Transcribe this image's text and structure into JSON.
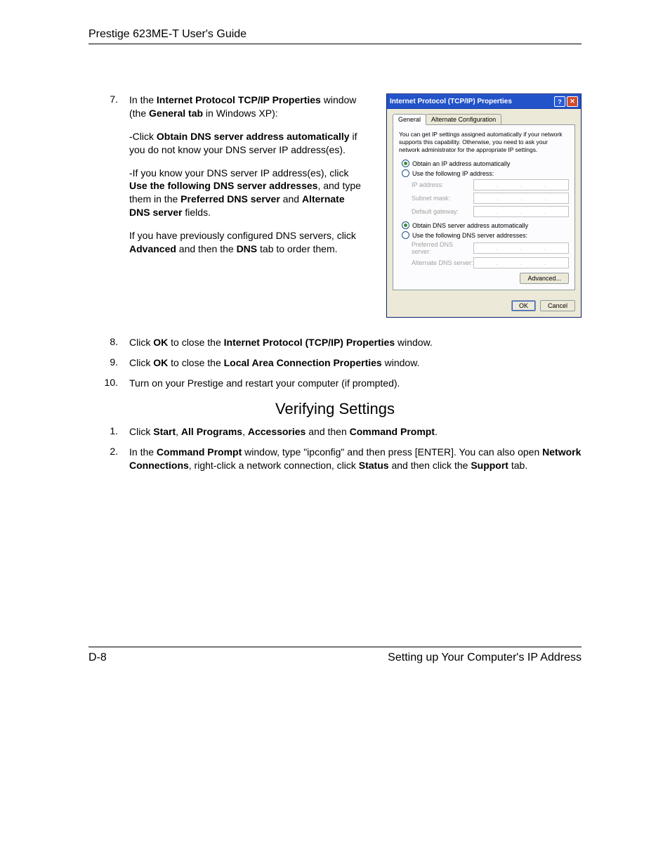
{
  "header": {
    "title": "Prestige 623ME-T User's Guide"
  },
  "footer": {
    "page": "D-8",
    "section": "Setting up Your Computer's IP Address"
  },
  "doc": {
    "step7": {
      "num": "7.",
      "p1a": "In the ",
      "p1b": "Internet Protocol TCP/IP Properties",
      "p1c": " window (the ",
      "p1d": "General tab",
      "p1e": " in Windows XP):",
      "p2a": "-Click ",
      "p2b": "Obtain DNS server address automatically",
      "p2c": " if you do not know your DNS server IP address(es).",
      "p3a": "-If you know your DNS server IP address(es), click ",
      "p3b": "Use the following DNS server addresses",
      "p3c": ", and type them in the ",
      "p3d": "Preferred DNS server",
      "p3e": " and ",
      "p3f": "Alternate DNS server",
      "p3g": " fields.",
      "p4a": "If you have previously configured DNS servers, click ",
      "p4b": "Advanced",
      "p4c": " and then the ",
      "p4d": "DNS",
      "p4e": " tab to order them."
    },
    "step8": {
      "num": "8.",
      "a": "Click ",
      "b": "OK",
      "c": " to close the ",
      "d": "Internet Protocol (TCP/IP) Properties",
      "e": " window."
    },
    "step9": {
      "num": "9.",
      "a": "Click ",
      "b": "OK",
      "c": " to close the ",
      "d": "Local Area Connection Properties",
      "e": " window."
    },
    "step10": {
      "num": "10.",
      "a": "Turn on your Prestige and restart your computer (if prompted)."
    },
    "section_title": "Verifying Settings",
    "v1": {
      "num": "1.",
      "a": "Click ",
      "b": "Start",
      "c": ", ",
      "d": "All Programs",
      "e": ", ",
      "f": "Accessories",
      "g": " and then ",
      "h": "Command Prompt",
      "i": "."
    },
    "v2": {
      "num": "2.",
      "a": "In the ",
      "b": "Command Prompt",
      "c": " window, type \"ipconfig\" and then press [ENTER]. You can also open ",
      "d": "Network Connections",
      "e": ", right-click a network connection, click ",
      "f": "Status",
      "g": " and then click the ",
      "h": "Support",
      "i": " tab."
    }
  },
  "xp": {
    "title": "Internet Protocol (TCP/IP) Properties",
    "help_glyph": "?",
    "close_glyph": "✕",
    "tab_general": "General",
    "tab_alt": "Alternate Configuration",
    "desc": "You can get IP settings assigned automatically if your network supports this capability. Otherwise, you need to ask your network administrator for the appropriate IP settings.",
    "radio_auto_ip": "Obtain an IP address automatically",
    "radio_use_ip": "Use the following IP address:",
    "lbl_ip": "IP address:",
    "lbl_subnet": "Subnet mask:",
    "lbl_gateway": "Default gateway:",
    "radio_auto_dns": "Obtain DNS server address automatically",
    "radio_use_dns": "Use the following DNS server addresses:",
    "lbl_pref_dns": "Preferred DNS server:",
    "lbl_alt_dns": "Alternate DNS server:",
    "btn_adv": "Advanced...",
    "btn_ok": "OK",
    "btn_cancel": "Cancel"
  }
}
